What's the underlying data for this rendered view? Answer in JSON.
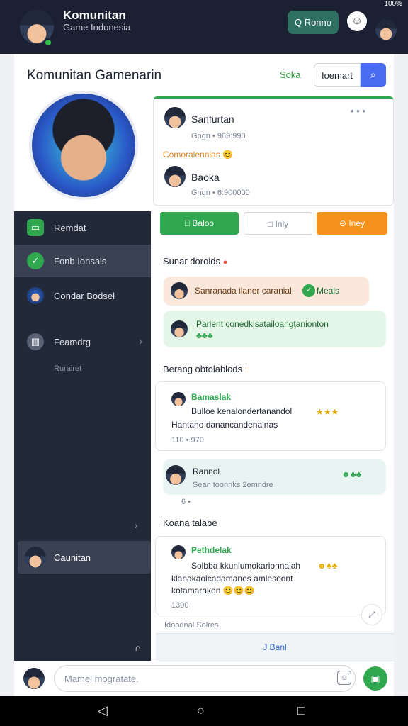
{
  "status": {
    "battery": "100%"
  },
  "topbar": {
    "title": "Komunitan",
    "subtitle": "Game Indonesia",
    "action_label": "Q Ronno",
    "emoji_icon": "smile-icon"
  },
  "header": {
    "title": "Komunitan Gamenarin",
    "link_label": "Soka",
    "input_value": "Ioemart",
    "icon": "search-icon"
  },
  "friends": {
    "first": {
      "name": "Sanfurtan",
      "meta": "Gngn • 969:990"
    },
    "section_label": "Comoralennias 😊",
    "second": {
      "name": "Baoka",
      "meta": "Gngn • 6:900000"
    },
    "more_label": "• • •"
  },
  "actions": {
    "green_label": "⎕ Baloo",
    "white_label": "□ Inly",
    "orange_label": "⊝ Iney"
  },
  "sidebar": {
    "items": [
      {
        "label": "Remdat",
        "icon": "chat-icon"
      },
      {
        "label": "Fonb Ionsais",
        "icon": "check-icon"
      },
      {
        "label": "Condar Bodsel",
        "icon": "avatar-icon"
      },
      {
        "label": "Feamdrg",
        "icon": "chart-icon"
      }
    ],
    "sub_label": "Rurairet",
    "user_label": "Caunitan",
    "bottom_icon": "∩"
  },
  "feed": {
    "section1": "Sunar doroids",
    "pill_orange": "Sanranada ilaner caranial",
    "pill_orange_tag": "Meals",
    "pill_green": "Parient conedkisatailoangtanionton",
    "section2": "Berang obtolablods",
    "post1": {
      "name": "Bamaslak",
      "text1": "Bulloe kenalondertanandol",
      "text2": "Hantano danancandenalnas",
      "meta": "110 • 970"
    },
    "reply": {
      "name": "Rannol",
      "meta": "Sean toonnks 2emndre",
      "foot": "6 •"
    },
    "section3": "Koana talabe",
    "post2": {
      "name": "Pethdelak",
      "text1": "Solbba kkunlumokarionnalah",
      "text2": "klanakaolcadamanes amlesoont",
      "text3": "kotamaraken 😊😊😊",
      "meta": "1390"
    },
    "footer_note": "Idoodnal Solres",
    "bottom_label": "J Banl"
  },
  "composer": {
    "placeholder": "Mamel mogratate.",
    "attach_icon": "sticker-icon",
    "send_icon": "send-icon"
  },
  "navbar": {
    "back": "◁",
    "home": "○",
    "recent": "□"
  },
  "colors": {
    "accent_green": "#2fa84f",
    "accent_orange": "#f5921c",
    "accent_blue": "#4a6cf0",
    "sidebar_bg": "#222939",
    "topbar_bg": "#1b2033"
  }
}
